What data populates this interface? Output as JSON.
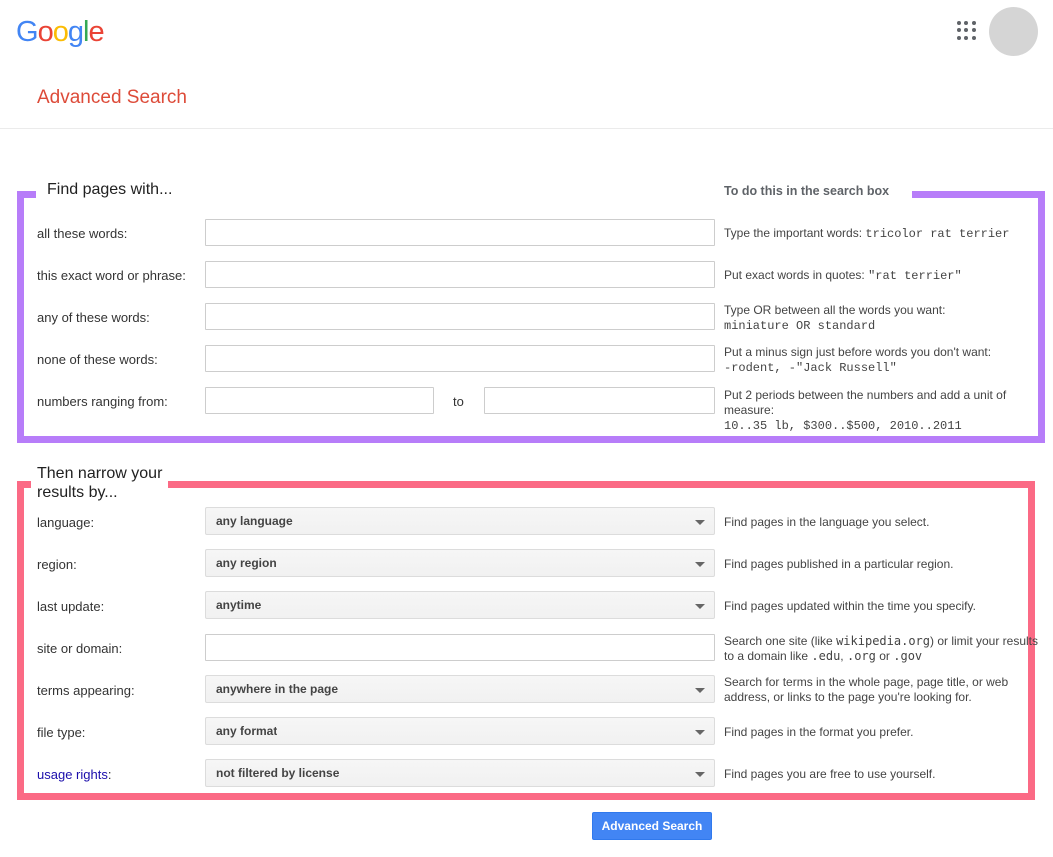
{
  "header": {
    "logo_text": "Google",
    "logo_letters": [
      {
        "ch": "G",
        "color": "#4285F4"
      },
      {
        "ch": "o",
        "color": "#EA4335"
      },
      {
        "ch": "o",
        "color": "#FBBC05"
      },
      {
        "ch": "g",
        "color": "#4285F4"
      },
      {
        "ch": "l",
        "color": "#34A853"
      },
      {
        "ch": "e",
        "color": "#EA4335"
      }
    ],
    "apps_icon": "apps-grid-icon",
    "avatar_icon": "account-avatar",
    "page_title": "Advanced Search",
    "title_color": "#dd4b39"
  },
  "find_section": {
    "title": "Find pages with...",
    "hint_column_title": "To do this in the search box",
    "accent_color": "#b77df9",
    "rows": [
      {
        "label": "all these words:",
        "value": "",
        "hint_text": "Type the important words:",
        "hint_code": "tricolor rat terrier"
      },
      {
        "label": "this exact word or phrase:",
        "value": "",
        "hint_text": "Put exact words in quotes:",
        "hint_code": "\"rat terrier\""
      },
      {
        "label": "any of these words:",
        "value": "",
        "hint_text": "Type OR between all the words you want:",
        "hint_code": "miniature OR standard"
      },
      {
        "label": "none of these words:",
        "value": "",
        "hint_text": "Put a minus sign just before words you don't want:",
        "hint_code": "-rodent, -\"Jack Russell\""
      }
    ],
    "numbers_row": {
      "label": "numbers ranging from:",
      "from_value": "",
      "to_value": "",
      "separator": "to",
      "hint_text": "Put 2 periods between the numbers and add a unit of measure:",
      "hint_code": "10..35 lb, $300..$500, 2010..2011"
    }
  },
  "narrow_section": {
    "title": "Then narrow your results by...",
    "accent_color": "#fb6a85",
    "rows": [
      {
        "label": "language:",
        "type": "select",
        "value": "any language",
        "hint": "Find pages in the language you select."
      },
      {
        "label": "region:",
        "type": "select",
        "value": "any region",
        "hint": "Find pages published in a particular region."
      },
      {
        "label": "last update:",
        "type": "select",
        "value": "anytime",
        "hint": "Find pages updated within the time you specify."
      },
      {
        "label": "site or domain:",
        "type": "input",
        "value": "",
        "hint_parts": {
          "a": "Search one site (like",
          "code1": "wikipedia.org",
          "b": ") or limit your results to a domain like",
          "code2": ".edu",
          "c": ",",
          "code3": ".org",
          "d": "or",
          "code4": ".gov"
        }
      },
      {
        "label": "terms appearing:",
        "type": "select",
        "value": "anywhere in the page",
        "hint": "Search for terms in the whole page, page title, or web address, or links to the page you're looking for."
      },
      {
        "label": "file type:",
        "type": "select",
        "value": "any format",
        "hint": "Find pages in the format you prefer."
      },
      {
        "label": "usage rights:",
        "label_link": "usage rights",
        "label_suffix": ":",
        "type": "select",
        "value": "not filtered by license",
        "hint": "Find pages you are free to use yourself."
      }
    ]
  },
  "submit": {
    "label": "Advanced Search",
    "color": "#4285f4"
  }
}
